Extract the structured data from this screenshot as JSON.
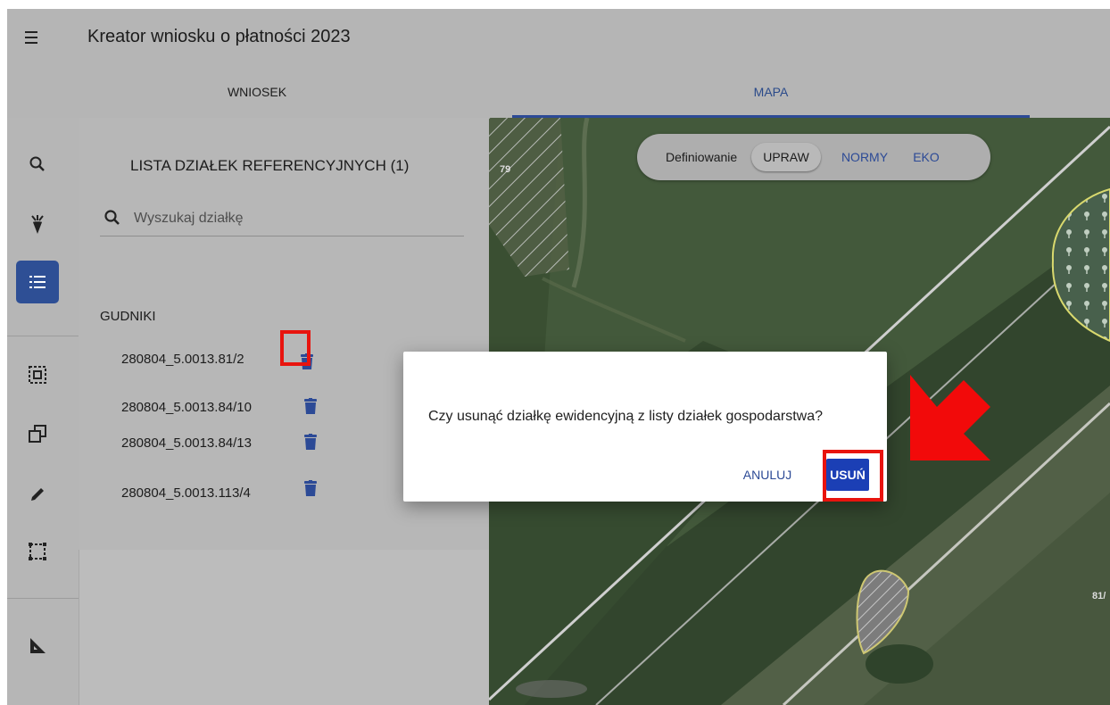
{
  "header": {
    "title": "Kreator wniosku o płatności 2023",
    "menu_icon": "hamburger-menu-icon"
  },
  "tabs": [
    {
      "label": "WNIOSEK",
      "active": false
    },
    {
      "label": "MAPA",
      "active": true
    }
  ],
  "toolbar": {
    "items": [
      {
        "icon": "search-icon"
      },
      {
        "icon": "crop-plant-icon"
      },
      {
        "icon": "list-icon",
        "active": true
      },
      {
        "icon": "select-area-icon"
      },
      {
        "icon": "copy-icon"
      },
      {
        "icon": "pencil-icon"
      },
      {
        "icon": "dashed-rectangle-icon"
      },
      {
        "icon": "ruler-triangle-icon"
      }
    ]
  },
  "map": {
    "toggle": {
      "label": "Definiowanie",
      "options": [
        {
          "label": "UPRAW",
          "selected": true
        },
        {
          "label": "NORMY",
          "selected": false
        },
        {
          "label": "EKO",
          "selected": false
        }
      ]
    },
    "parcel_labels": [
      "79",
      "81/"
    ]
  },
  "panel": {
    "title": "LISTA DZIAŁEK REFERENCYJNYCH (1)",
    "search_placeholder": "Wyszukaj działkę",
    "group": "GUDNIKI",
    "parcels": [
      {
        "code": "280804_5.0013.81/2",
        "highlighted": true
      },
      {
        "code": "280804_5.0013.84/10",
        "highlighted": false
      },
      {
        "code": "280804_5.0013.84/13",
        "highlighted": false
      },
      {
        "code": "280804_5.0013.113/4",
        "highlighted": false
      }
    ]
  },
  "dialog": {
    "message": "Czy usunąć działkę ewidencyjną z listy działek gospodarstwa?",
    "cancel_label": "ANULUJ",
    "confirm_label": "USUŃ"
  },
  "colors": {
    "accent_blue": "#2c4a96",
    "confirm_button": "#1b3fb5",
    "highlight_red": "#e8140e"
  }
}
